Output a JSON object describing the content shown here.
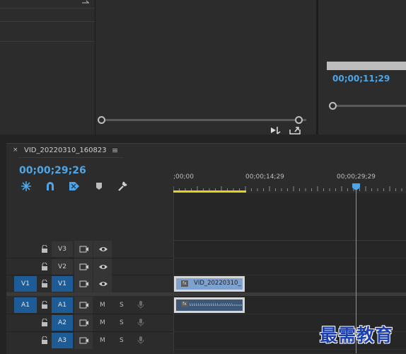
{
  "sequence": {
    "title": "VID_20220310_160823",
    "timecode": "00;00;29;26"
  },
  "program": {
    "timecode": "00;00;11;29"
  },
  "ruler": {
    "labels": [
      ";00;00",
      "00;00;14;29",
      "00;00;29;29"
    ]
  },
  "tracks": {
    "video": [
      {
        "name": "V3",
        "source": ""
      },
      {
        "name": "V2",
        "source": ""
      },
      {
        "name": "V1",
        "source": "V1"
      }
    ],
    "audio": [
      {
        "name": "A1",
        "source": "A1",
        "mute": "M",
        "solo": "S"
      },
      {
        "name": "A2",
        "source": "",
        "mute": "M",
        "solo": "S"
      },
      {
        "name": "A3",
        "source": "",
        "mute": "M",
        "solo": "S"
      }
    ]
  },
  "clips": {
    "video_clip_label": "VID_20220310_",
    "fx_badge": "fx"
  },
  "icons": {
    "tab_close": "×",
    "tab_menu": "≡"
  },
  "colors": {
    "accent_blue": "#4ea6e8",
    "track_target_blue": "#1d5c96",
    "inout_yellow": "#e5d21c",
    "video_clip": "#7fa1cf",
    "audio_clip": "#3d5779"
  },
  "watermark": "最需教育"
}
